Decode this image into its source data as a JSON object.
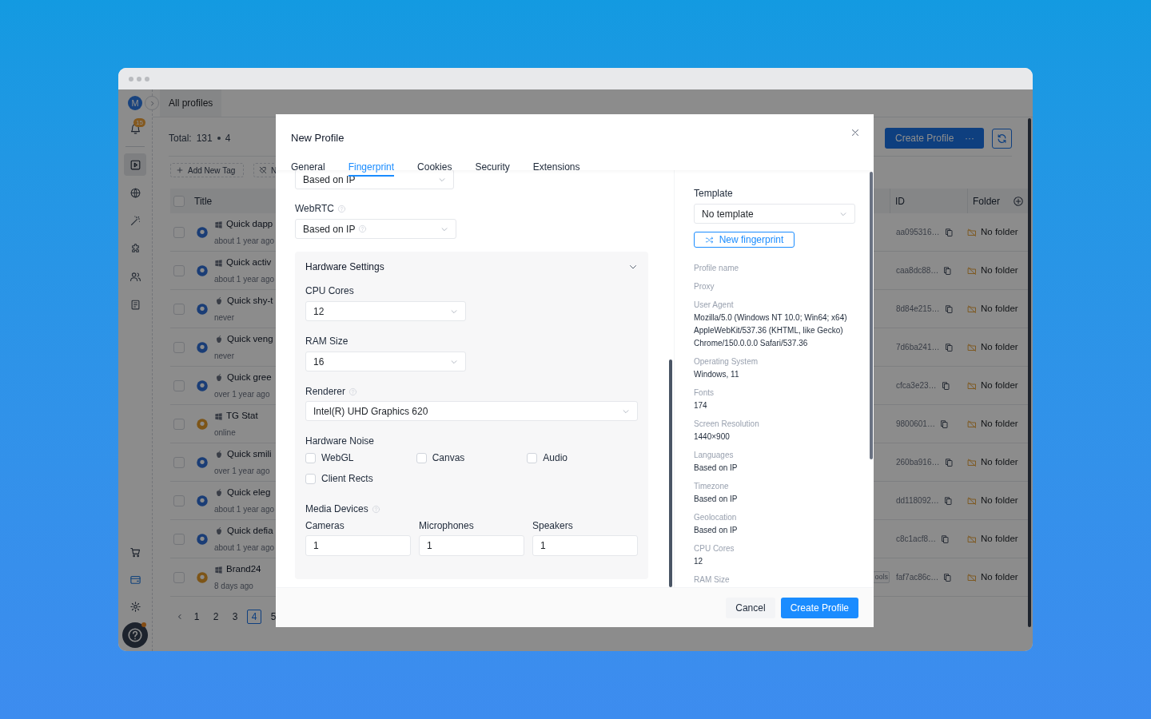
{
  "sidebar": {
    "avatar": "M",
    "badge": "15",
    "items": [
      {
        "selected": true
      },
      {
        "selected": false
      },
      {
        "selected": false
      },
      {
        "selected": false
      },
      {
        "selected": false
      },
      {
        "selected": false
      }
    ],
    "bottom_items": [
      {
        "selected": false
      },
      {
        "selected": true
      },
      {
        "selected": false
      }
    ],
    "help_alert": true
  },
  "app": {
    "tab": "All profiles",
    "total_label": "Total:",
    "total": "131",
    "selected_count": "4",
    "toolbar": [
      "Add New Tag",
      "N"
    ],
    "create_button": "Create Profile",
    "create_more": "···",
    "columns": [
      "Title",
      "ID",
      "Folder"
    ],
    "all_checked": false,
    "rows": [
      {
        "checked": false,
        "kind": "windows",
        "color": "#1a3d76",
        "title": "Quick dapp",
        "subtitle": "about 1 year ago",
        "id": "aa095316…",
        "folder": "No folder"
      },
      {
        "checked": false,
        "kind": "windows",
        "color": "#1a3d76",
        "title": "Quick activ",
        "subtitle": "about 1 year ago",
        "id": "caa8dc88…",
        "folder": "No folder"
      },
      {
        "checked": false,
        "kind": "apple",
        "color": "#1a3d76",
        "title": "Quick shy-t",
        "subtitle": "never",
        "id": "8d84e215…",
        "folder": "No folder"
      },
      {
        "checked": false,
        "kind": "apple",
        "color": "#1a3d76",
        "title": "Quick veng",
        "subtitle": "never",
        "id": "7d6ba241…",
        "folder": "No folder"
      },
      {
        "checked": false,
        "kind": "apple",
        "color": "#1a3d76",
        "title": "Quick gree",
        "subtitle": "over 1 year ago",
        "id": "cfca3e23…",
        "folder": "No folder"
      },
      {
        "checked": false,
        "kind": "windows",
        "color": "#7d5517",
        "title": "TG Stat",
        "subtitle": "online",
        "id": "9800601…",
        "folder": "No folder"
      },
      {
        "checked": false,
        "kind": "apple",
        "color": "#1a3d76",
        "title": "Quick smili",
        "subtitle": "over 1 year ago",
        "id": "260ba916…",
        "folder": "No folder"
      },
      {
        "checked": false,
        "kind": "apple",
        "color": "#1a3d76",
        "title": "Quick eleg",
        "subtitle": "about 1 year ago",
        "id": "dd118092…",
        "folder": "No folder"
      },
      {
        "checked": false,
        "kind": "apple",
        "color": "#1a3d76",
        "title": "Quick defia",
        "subtitle": "about 1 year ago",
        "id": "c8c1acf8…",
        "folder": "No folder"
      },
      {
        "checked": false,
        "kind": "windows",
        "color": "#7d5517",
        "title": "Brand24",
        "subtitle": "8 days ago",
        "tag": "ools",
        "id": "faf7ac86c…",
        "folder": "No folder"
      }
    ],
    "pagination": [
      {
        "label": "1",
        "selected": false
      },
      {
        "label": "2",
        "selected": false
      },
      {
        "label": "3",
        "selected": false
      },
      {
        "label": "4",
        "selected": true
      },
      {
        "label": "5",
        "selected": false
      }
    ]
  },
  "modal": {
    "title": "New Profile",
    "tabs": [
      {
        "label": "General",
        "selected": false
      },
      {
        "label": "Fingerprint",
        "selected": true
      },
      {
        "label": "Cookies",
        "selected": false
      },
      {
        "label": "Security",
        "selected": false
      },
      {
        "label": "Extensions",
        "selected": false
      }
    ],
    "partial_select": "Based on IP",
    "webrtc": {
      "label": "WebRTC",
      "value": "Based on IP"
    },
    "hardware": {
      "title": "Hardware Settings",
      "expanded": true,
      "cpu": {
        "label": "CPU Cores",
        "value": "12"
      },
      "ram": {
        "label": "RAM Size",
        "value": "16"
      },
      "renderer": {
        "label": "Renderer",
        "value": "Intel(R) UHD Graphics 620"
      },
      "noise_label": "Hardware Noise",
      "noise": [
        {
          "label": "WebGL",
          "checked": false
        },
        {
          "label": "Canvas",
          "checked": false
        },
        {
          "label": "Audio",
          "checked": false
        },
        {
          "label": "Client Rects",
          "checked": false
        }
      ],
      "media_label": "Media Devices",
      "media": [
        {
          "label": "Cameras",
          "value": "1"
        },
        {
          "label": "Microphones",
          "value": "1"
        },
        {
          "label": "Speakers",
          "value": "1"
        }
      ]
    },
    "summary": {
      "template_label": "Template",
      "template": "No template",
      "new_fingerprint": "New fingerprint",
      "fields": [
        {
          "label": "Profile name"
        },
        {
          "label": "Proxy"
        },
        {
          "label": "User Agent",
          "lines": [
            "Mozilla/5.0 (Windows NT 10.0; Win64; x64)",
            "AppleWebKit/537.36 (KHTML, like Gecko)",
            "Chrome/150.0.0.0 Safari/537.36"
          ]
        },
        {
          "label": "Operating System",
          "lines": [
            "Windows, 11"
          ]
        },
        {
          "label": "Fonts",
          "lines": [
            "174"
          ]
        },
        {
          "label": "Screen Resolution",
          "lines": [
            "1440×900"
          ]
        },
        {
          "label": "Languages",
          "lines": [
            "Based on IP"
          ]
        },
        {
          "label": "Timezone",
          "lines": [
            "Based on IP"
          ]
        },
        {
          "label": "Geolocation",
          "lines": [
            "Based on IP"
          ]
        },
        {
          "label": "CPU Cores",
          "lines": [
            "12"
          ]
        },
        {
          "label": "RAM Size"
        }
      ]
    },
    "buttons": [
      "Cancel",
      "Create Profile"
    ]
  }
}
